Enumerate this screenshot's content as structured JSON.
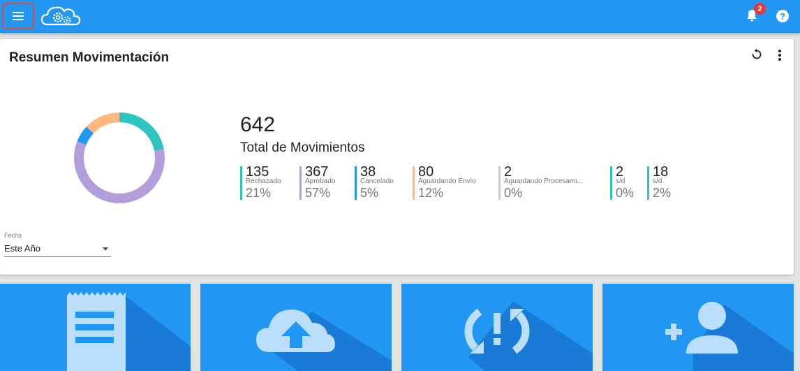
{
  "topbar": {
    "notification_count": "2",
    "help_glyph": "?"
  },
  "card": {
    "title": "Resumen Movimentación",
    "total_value": "642",
    "total_label": "Total de Movimientos",
    "stats": [
      {
        "value": "135",
        "label": "Rechazado",
        "percent": "21%",
        "color": "#2ec4c0"
      },
      {
        "value": "367",
        "label": "Aprobado",
        "percent": "57%",
        "color": "#b39ddb"
      },
      {
        "value": "38",
        "label": "Cancelado",
        "percent": "5%",
        "color": "#2196f3"
      },
      {
        "value": "80",
        "label": "Aguardando Envío",
        "percent": "12%",
        "color": "#ffb880"
      },
      {
        "value": "2",
        "label": "Aguardando Procesami...",
        "percent": "0%",
        "color": "#c8c8c8"
      },
      {
        "value": "2",
        "label": "s/d",
        "percent": "0%",
        "color": "#2ec4c0"
      },
      {
        "value": "18",
        "label": "s/d",
        "percent": "2%",
        "color": "#2ec4c0"
      }
    ],
    "donut_segments": [
      {
        "value": 135,
        "color": "#2ec4c0"
      },
      {
        "value": 367,
        "color": "#b39ddb"
      },
      {
        "value": 38,
        "color": "#2196f3"
      },
      {
        "value": 80,
        "color": "#ffb880"
      }
    ],
    "filter": {
      "label": "Fecha",
      "value": "Este Año"
    }
  },
  "tiles": [
    {
      "icon": "receipt-icon"
    },
    {
      "icon": "cloud-upload-icon"
    },
    {
      "icon": "sync-problem-icon"
    },
    {
      "icon": "add-user-icon"
    }
  ],
  "colors": {
    "primary": "#2196f3",
    "tile_shadow": "#1565c0",
    "icon_light": "#bbdefb"
  }
}
